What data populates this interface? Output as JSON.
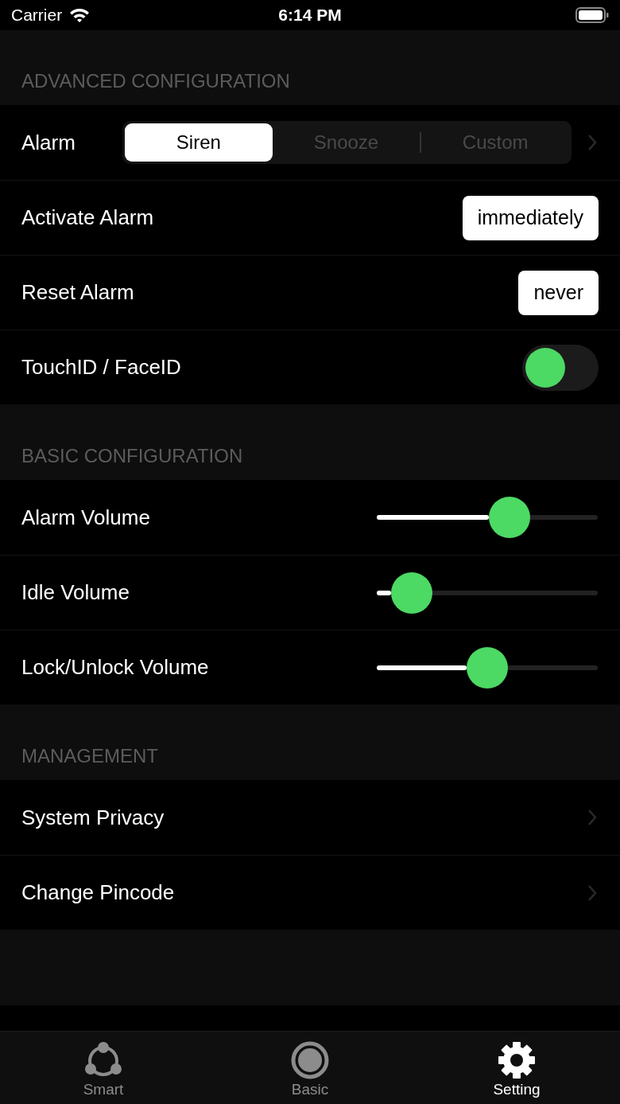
{
  "status_bar": {
    "carrier": "Carrier",
    "time": "6:14 PM"
  },
  "sections": [
    {
      "header": "ADVANCED CONFIGURATION",
      "rows": [
        {
          "kind": "segmented",
          "label": "Alarm",
          "segments": [
            {
              "label": "Siren",
              "selected": true
            },
            {
              "label": "Snooze",
              "selected": false
            },
            {
              "label": "Custom",
              "selected": false
            }
          ]
        },
        {
          "kind": "value",
          "label": "Activate Alarm",
          "value": "immediately"
        },
        {
          "kind": "value",
          "label": "Reset Alarm",
          "value": "never"
        },
        {
          "kind": "toggle",
          "label": "TouchID / FaceID",
          "on": false
        }
      ]
    },
    {
      "header": "BASIC CONFIGURATION",
      "rows": [
        {
          "kind": "slider",
          "label": "Alarm Volume",
          "level": 0.6
        },
        {
          "kind": "slider",
          "label": "Idle Volume",
          "level": 0.16
        },
        {
          "kind": "slider",
          "label": "Lock/Unlock Volume",
          "level": 0.5
        }
      ]
    },
    {
      "header": "MANAGEMENT",
      "rows": [
        {
          "kind": "link",
          "label": "System Privacy"
        },
        {
          "kind": "link",
          "label": "Change Pincode"
        }
      ]
    }
  ],
  "tab_bar": [
    {
      "label": "Smart",
      "selected": false
    },
    {
      "label": "Basic",
      "selected": false
    },
    {
      "label": "Setting",
      "selected": true
    }
  ]
}
